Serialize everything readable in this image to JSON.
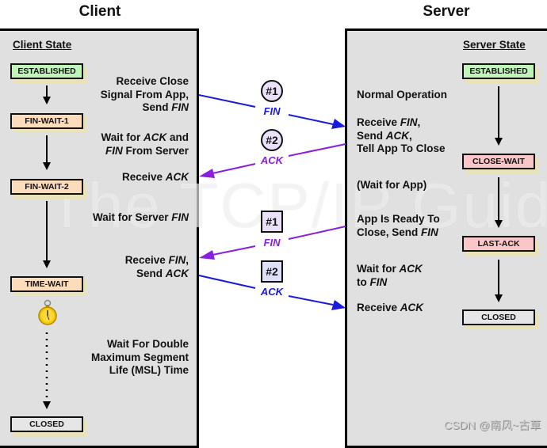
{
  "titles": {
    "client": "Client",
    "server": "Server"
  },
  "client": {
    "heading": "Client State",
    "states": [
      {
        "label": "ESTABLISHED",
        "color": "#bff5b8"
      },
      {
        "label": "FIN-WAIT-1",
        "color": "#fddcbc"
      },
      {
        "label": "FIN-WAIT-2",
        "color": "#fddcbc"
      },
      {
        "label": "TIME-WAIT",
        "color": "#fddcbc"
      },
      {
        "label": "CLOSED",
        "color": "#e6e6e6"
      }
    ],
    "descriptions": [
      {
        "lines": [
          "Receive Close",
          "Signal From App,",
          "Send |FIN|"
        ]
      },
      {
        "lines": [
          "Wait for |ACK| and",
          "|FIN| From Server"
        ]
      },
      {
        "lines": [
          "Receive |ACK|"
        ]
      },
      {
        "lines": [
          "Wait for Server |FIN|"
        ]
      },
      {
        "lines": [
          "Receive |FIN|,",
          "Send |ACK|"
        ]
      },
      {
        "lines": [
          "Wait For Double",
          "Maximum Segment",
          "Life (MSL) Time"
        ]
      }
    ],
    "timer_icon": "stopwatch-icon"
  },
  "server": {
    "heading": "Server State",
    "states": [
      {
        "label": "ESTABLISHED",
        "color": "#bff5b8"
      },
      {
        "label": "CLOSE-WAIT",
        "color": "#fbc6c8"
      },
      {
        "label": "LAST-ACK",
        "color": "#fbc6c8"
      },
      {
        "label": "CLOSED",
        "color": "#e6e6e6"
      }
    ],
    "descriptions": [
      {
        "lines": [
          "Normal Operation"
        ]
      },
      {
        "lines": [
          "Receive |FIN|,",
          "Send |ACK|,",
          "Tell App To Close"
        ]
      },
      {
        "lines": [
          "(Wait for App)"
        ]
      },
      {
        "lines": [
          "App Is Ready To",
          "Close, Send |FIN|"
        ]
      },
      {
        "lines": [
          "Wait for |ACK|",
          "to |FIN|"
        ]
      },
      {
        "lines": [
          "Receive |ACK|"
        ]
      }
    ]
  },
  "messages": [
    {
      "number": "#1",
      "label": "FIN",
      "direction": "client-to-server",
      "color": "#1a1adf",
      "shape": "circle"
    },
    {
      "number": "#2",
      "label": "ACK",
      "direction": "server-to-client",
      "color": "#8a1ee0",
      "shape": "circle"
    },
    {
      "number": "#1",
      "label": "FIN",
      "direction": "server-to-client",
      "color": "#8a1ee0",
      "shape": "square"
    },
    {
      "number": "#2",
      "label": "ACK",
      "direction": "client-to-server",
      "color": "#1a1adf",
      "shape": "square"
    }
  ],
  "watermarks": {
    "center": "The TCP/IP Guide",
    "corner": "CSDN @南风~古草"
  }
}
